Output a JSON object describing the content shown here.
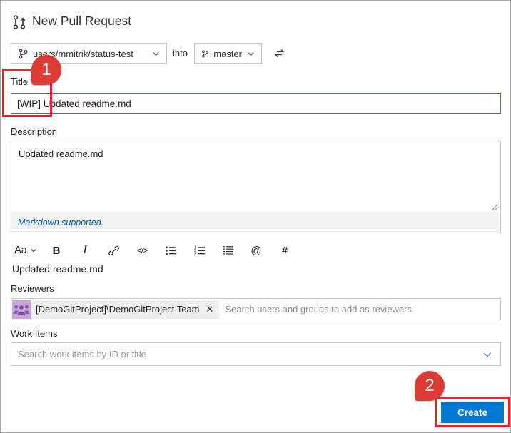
{
  "header": {
    "title": "New Pull Request"
  },
  "branch_bar": {
    "source_branch": "users/mmitrik/status-test",
    "into_label": "into",
    "target_branch": "master"
  },
  "callouts": {
    "step1": "1",
    "step2": "2"
  },
  "title_section": {
    "label": "Title",
    "required_mark": "*",
    "value": "[WIP] Updated readme.md"
  },
  "description_section": {
    "label": "Description",
    "value": "Updated readme.md",
    "footer_note": "Markdown supported."
  },
  "toolbar": {
    "format_label": "Aa",
    "bold_label": "B",
    "italic_label": "I",
    "code_label": "</>",
    "mention_label": "@",
    "workitem_label": "#"
  },
  "preview": {
    "text": "Updated readme.md"
  },
  "reviewers_section": {
    "label": "Reviewers",
    "chip": {
      "name": "[DemoGitProject]\\DemoGitProject Team",
      "remove_label": "✕"
    },
    "placeholder": "Search users and groups to add as reviewers"
  },
  "work_items_section": {
    "label": "Work Items",
    "placeholder": "Search work items by ID or title"
  },
  "actions": {
    "create_label": "Create"
  },
  "colors": {
    "accent_blue": "#0078d4",
    "focus_border_blue": "#1a7ac7",
    "callout_red": "#e32430",
    "badge_red": "#dd3b35",
    "avatar_purple": "#c9a3da",
    "avatar_figures_purple": "#8a5aa8"
  }
}
